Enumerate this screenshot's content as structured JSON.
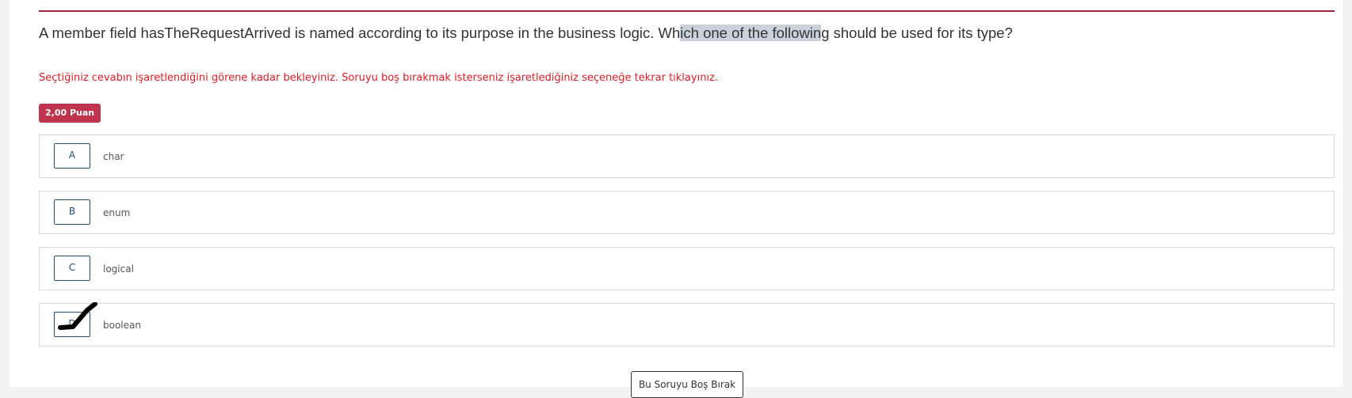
{
  "question": {
    "text_before": "A member field hasTheRequestArrived is named according to its purpose in the business logic. Wh",
    "text_highlight": "ich one of the followin",
    "text_after": "g should be used for its type?"
  },
  "warning": "Seçtiğiniz cevabın işaretlendiğini görene kadar bekleyiniz. Soruyu boş bırakmak isterseniz işaretlediğiniz seçeneğe tekrar tıklayınız.",
  "points_badge": "2,00 Puan",
  "options": [
    {
      "letter": "A",
      "text": "char"
    },
    {
      "letter": "B",
      "text": "enum"
    },
    {
      "letter": "C",
      "text": "logical"
    },
    {
      "letter": "D",
      "text": "boolean",
      "selected": true
    }
  ],
  "skip_button": "Bu Soruyu Boş Bırak",
  "colors": {
    "accent": "#a3243a",
    "warning": "#e31b23",
    "badge": "#c0334d",
    "option_border": "#1f4e79"
  }
}
